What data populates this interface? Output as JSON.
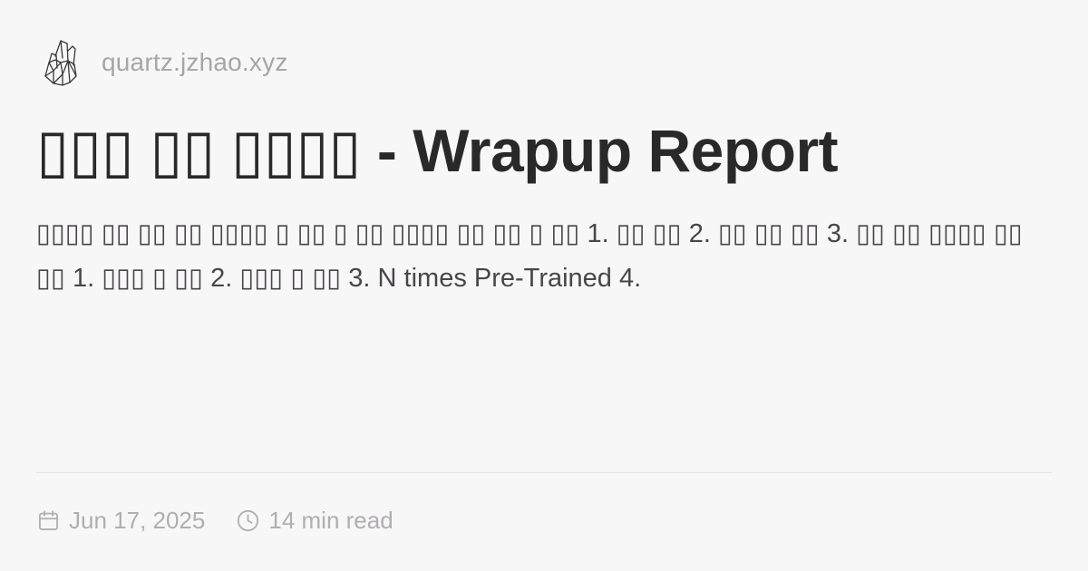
{
  "header": {
    "logo_icon": "crystal-logo-icon",
    "site_name": "quartz.jzhao.xyz"
  },
  "article": {
    "title": "▯▯▯ ▯▯ ▯▯▯▯ - Wrapup Report",
    "description": "▯▯▯▯ ▯▯ ▯▯ ▯▯ ▯▯▯▯ ▯ ▯▯ ▯ ▯▯ ▯▯▯▯ ▯▯ ▯▯ ▯ ▯▯ 1. ▯▯ ▯▯ 2. ▯▯ ▯▯ ▯▯ 3. ▯▯ ▯▯ ▯▯▯▯ ▯▯ ▯▯ 1. ▯▯▯ ▯ ▯▯ 2. ▯▯▯ ▯ ▯▯ 3. N times Pre-Trained 4."
  },
  "meta": {
    "date_icon": "calendar-icon",
    "date": "Jun 17, 2025",
    "read_time_icon": "clock-icon",
    "read_time": "14 min read"
  },
  "colors": {
    "background": "#f8f7f8",
    "title": "#2a292a",
    "body_text": "#484648",
    "muted": "#a7a5a7"
  }
}
